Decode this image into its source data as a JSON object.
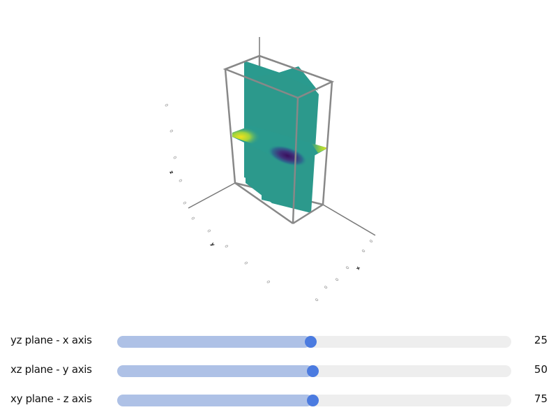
{
  "colors": {
    "accent": "#4b7be0",
    "fill": "#aec1e6",
    "track": "#eeeeee",
    "box": "#888888",
    "plane": "#2a9a8e"
  },
  "scene": {
    "axes": {
      "x": "x",
      "y": "y",
      "z": "z"
    },
    "ticks_z": [
      "0",
      "0",
      "0",
      "0",
      "0",
      "0",
      "0",
      "0"
    ],
    "ticks_y": [
      "0",
      "0",
      "0",
      "0",
      "0",
      "0"
    ],
    "ticks_x": [
      "0",
      "0",
      "0",
      "0",
      "0",
      "0",
      "0"
    ]
  },
  "sliders": [
    {
      "label": "yz plane - x axis",
      "value": "25",
      "fraction": 0.49
    },
    {
      "label": "xz plane - y axis",
      "value": "50",
      "fraction": 0.495
    },
    {
      "label": "xy plane - z axis",
      "value": "75",
      "fraction": 0.495
    }
  ]
}
